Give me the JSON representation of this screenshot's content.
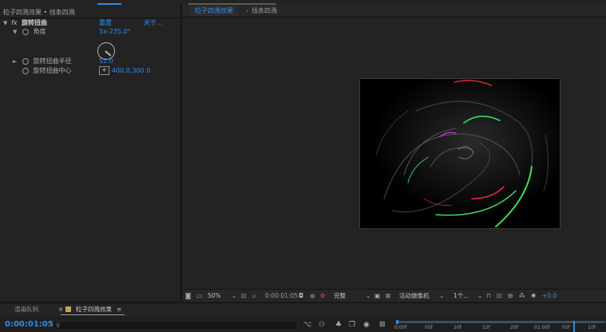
{
  "left_panel": {
    "header": "粒子四溅效果 • 线条四溅",
    "effect": {
      "fx_label": "fx",
      "name": "旋转扭曲",
      "reset_label": "重置",
      "about_label": "关于..."
    },
    "properties": [
      {
        "label": "角度",
        "value": "5x-235.0°"
      },
      {
        "label": "旋转扭曲半径",
        "value": "52.0"
      },
      {
        "label": "旋转扭曲中心",
        "value": "400.0,300.0"
      }
    ]
  },
  "viewer": {
    "tab_active": "粒子四溅效果",
    "tab_separator": "‹",
    "tab_other": "线条四溅",
    "toolbar": {
      "zoom": "50%",
      "timecode": "0:00:01:05",
      "resolution": "完整",
      "camera": "活动摄像机",
      "views": "1个...",
      "exposure": "+0.0"
    }
  },
  "timeline": {
    "tab_render_queue": "渲染队列",
    "tab_comp": "粒子四溅效果",
    "current_time": "0:00:01:05",
    "search_placeholder": "",
    "ruler_labels": [
      "0:00f",
      "05f",
      "10f",
      "15f",
      "20f",
      "01:00f",
      "05f",
      "10f"
    ]
  },
  "colors": {
    "accent": "#2e8cf0",
    "panel_bg": "#232323",
    "swirl_green": "#3ddc5a",
    "swirl_red": "#d8283a",
    "swirl_magenta": "#c23bd6"
  }
}
